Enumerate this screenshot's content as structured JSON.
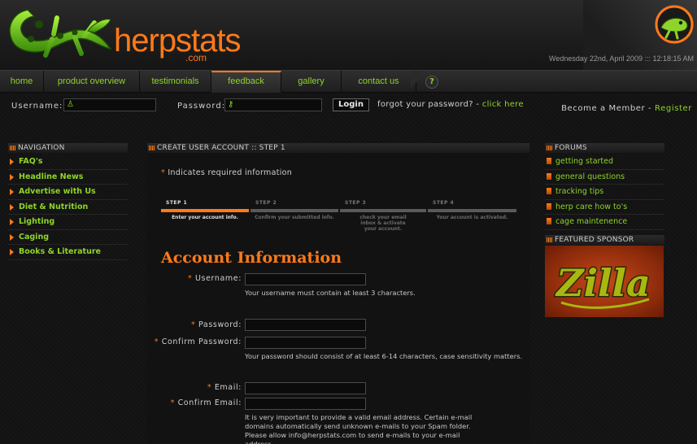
{
  "brand": {
    "name": "herpstats",
    "tld": ".com",
    "datetime": "Wednesday 22nd, April 2009 ::: 12:18:15 AM"
  },
  "nav": {
    "items": [
      "home",
      "product overview",
      "testimonials",
      "feedback",
      "gallery",
      "contact us"
    ],
    "help": "?"
  },
  "login": {
    "username_label": "Username:",
    "password_label": "Password:",
    "login_button": "Login",
    "forgot_text": "forgot your password? - ",
    "forgot_link": "click here",
    "member_text": "Become a Member - ",
    "register_link": "Register"
  },
  "left": {
    "heading": "NAVIGATION",
    "items": [
      "FAQ's",
      "Headline News",
      "Advertise with Us",
      "Diet & Nutrition",
      "Lighting",
      "Caging",
      "Books & Literature"
    ]
  },
  "right": {
    "forums_heading": "FORUMS",
    "forums": [
      "getting started",
      "general questions",
      "tracking tips",
      "herp care how to's",
      "cage maintenence"
    ],
    "sponsor_heading": "FEATURED SPONSOR",
    "sponsor_logo": "Zilla"
  },
  "main": {
    "heading": "CREATE USER ACCOUNT :: STEP 1",
    "required_star": "*",
    "required_note": "Indicates required information",
    "steps": [
      {
        "title": "STEP 1",
        "desc": "Enter your account info."
      },
      {
        "title": "STEP 2",
        "desc": "Confirm your submitted info."
      },
      {
        "title": "STEP 3",
        "desc": "check your email inbox & activate your account."
      },
      {
        "title": "STEP 4",
        "desc": "Your account is activated."
      }
    ],
    "section_title": "Account Information",
    "fields": {
      "username": "Username:",
      "password": "Password:",
      "confirm_password": "Confirm Password:",
      "email": "Email:",
      "confirm_email": "Confirm Email:"
    },
    "hints": {
      "username": "Your username must contain at least 3 characters.",
      "password": "Your password should consist of at least 6-14 characters, case sensitivity matters.",
      "email": "It is very important to provide a valid email address. Certain e-mail domains automatically send unknown e-mails to your Spam folder. Please allow info@herpstats.com to send e-mails to your e-mail address."
    }
  },
  "colors": {
    "accent": "#ff7a1a",
    "link": "#8ed42a",
    "background": "#141414"
  }
}
